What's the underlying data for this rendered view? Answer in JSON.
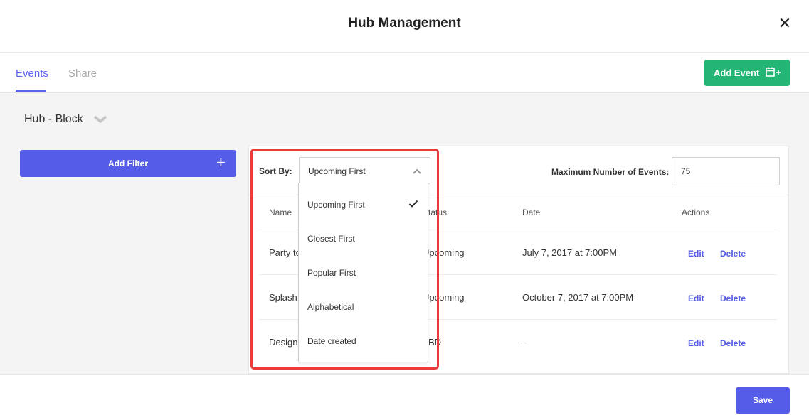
{
  "header": {
    "title": "Hub Management",
    "close_icon": "close-icon"
  },
  "tabs": [
    {
      "label": "Events",
      "active": true
    },
    {
      "label": "Share",
      "active": false
    }
  ],
  "toolbar": {
    "add_event_label": "Add Event",
    "add_event_icon": "calendar-plus-icon"
  },
  "hub": {
    "selected": "Hub - Block"
  },
  "filter": {
    "add_filter_label": "Add Filter"
  },
  "sort": {
    "label": "Sort By:",
    "selected": "Upcoming First",
    "options": [
      "Upcoming First",
      "Closest First",
      "Popular First",
      "Alphabetical",
      "Date created"
    ]
  },
  "max_events": {
    "label": "Maximum Number of Events:",
    "value": "75"
  },
  "table": {
    "columns": [
      "Name",
      "Status",
      "Date",
      "Actions"
    ],
    "rows": [
      {
        "name": "Party to",
        "status": "Upcoming",
        "date": "July 7, 2017 at 7:00PM",
        "edit": "Edit",
        "delete": "Delete"
      },
      {
        "name": "Splash Y",
        "status": "Upcoming",
        "date": "October 7, 2017 at 7:00PM",
        "edit": "Edit",
        "delete": "Delete"
      },
      {
        "name": "Designi",
        "status": "TBD",
        "date": "-",
        "edit": "Edit",
        "delete": "Delete"
      }
    ]
  },
  "footer": {
    "save_label": "Save"
  },
  "colors": {
    "accent": "#555de8",
    "success": "#22b573",
    "highlight": "#ea3a3a"
  }
}
